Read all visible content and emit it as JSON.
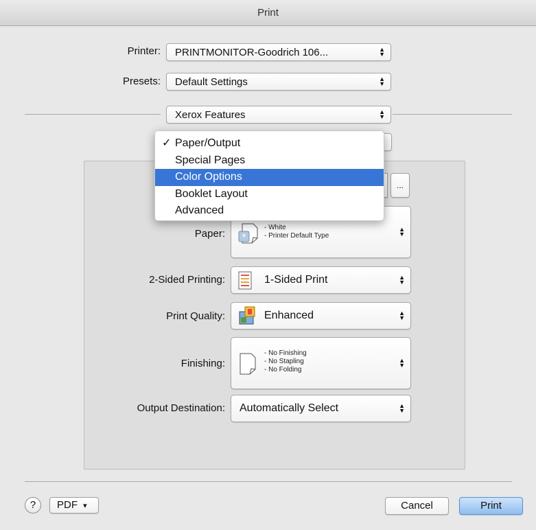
{
  "window": {
    "title": "Print"
  },
  "printer": {
    "label": "Printer:",
    "value": "PRINTMONITOR-Goodrich 106..."
  },
  "presets": {
    "label": "Presets:",
    "value": "Default Settings"
  },
  "section": {
    "value": "Xerox Features"
  },
  "menu": {
    "items": [
      {
        "label": "Paper/Output",
        "checked": true,
        "highlighted": false
      },
      {
        "label": "Special Pages",
        "checked": false,
        "highlighted": false
      },
      {
        "label": "Color Options",
        "checked": false,
        "highlighted": true
      },
      {
        "label": "Booklet Layout",
        "checked": false,
        "highlighted": false
      },
      {
        "label": "Advanced",
        "checked": false,
        "highlighted": false
      }
    ],
    "check_glyph": "✓"
  },
  "more_button": "...",
  "paper": {
    "label": "Paper:",
    "lines": [
      "- White",
      "- Printer Default Type"
    ]
  },
  "sided": {
    "label": "2-Sided Printing:",
    "value": "1-Sided Print"
  },
  "quality": {
    "label": "Print Quality:",
    "value": "Enhanced"
  },
  "finishing": {
    "label": "Finishing:",
    "lines": [
      "- No Finishing",
      "- No Stapling",
      "- No Folding"
    ]
  },
  "output": {
    "label": "Output Destination:",
    "value": "Automatically Select"
  },
  "footer": {
    "help": "?",
    "pdf": "PDF",
    "pdf_arrow": "▾",
    "cancel": "Cancel",
    "print": "Print"
  },
  "colors": {
    "highlight": "#3875d7",
    "default_button": "#8fbdf0"
  }
}
